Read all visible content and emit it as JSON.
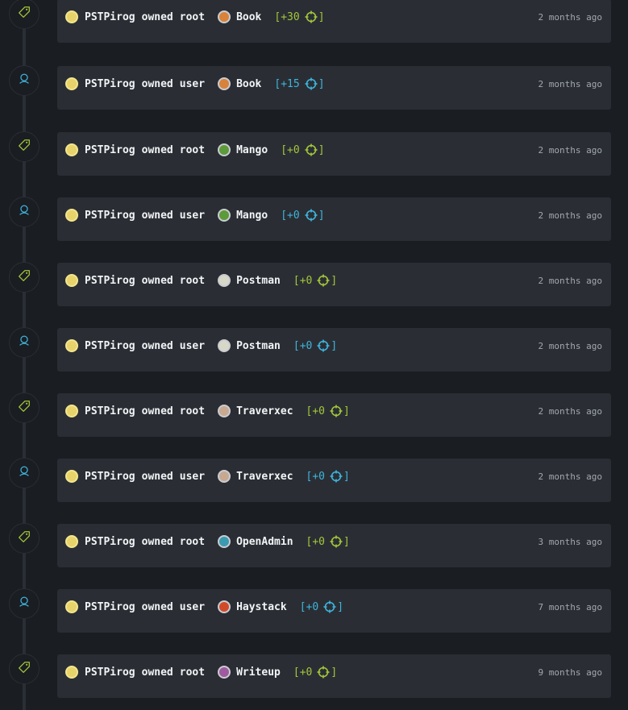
{
  "colors": {
    "root": "#a4c63a",
    "user": "#3fb4dc"
  },
  "feed": [
    {
      "type": "root",
      "icon": "tag-icon",
      "user": "PSTPirog",
      "verb": "owned",
      "what": "root",
      "machine": "Book",
      "points": "[+30",
      "close": "]",
      "time": "2 months ago",
      "avatar_color": "#d9823a"
    },
    {
      "type": "user",
      "icon": "user-icon",
      "user": "PSTPirog",
      "verb": "owned",
      "what": "user",
      "machine": "Book",
      "points": "[+15",
      "close": "]",
      "time": "2 months ago",
      "avatar_color": "#d9823a"
    },
    {
      "type": "root",
      "icon": "tag-icon",
      "user": "PSTPirog",
      "verb": "owned",
      "what": "root",
      "machine": "Mango",
      "points": "[+0",
      "close": "]",
      "time": "2 months ago",
      "avatar_color": "#5c9a3a"
    },
    {
      "type": "user",
      "icon": "user-icon",
      "user": "PSTPirog",
      "verb": "owned",
      "what": "user",
      "machine": "Mango",
      "points": "[+0",
      "close": "]",
      "time": "2 months ago",
      "avatar_color": "#5c9a3a"
    },
    {
      "type": "root",
      "icon": "tag-icon",
      "user": "PSTPirog",
      "verb": "owned",
      "what": "root",
      "machine": "Postman",
      "points": "[+0",
      "close": "]",
      "time": "2 months ago",
      "avatar_color": "#d8d8c8"
    },
    {
      "type": "user",
      "icon": "user-icon",
      "user": "PSTPirog",
      "verb": "owned",
      "what": "user",
      "machine": "Postman",
      "points": "[+0",
      "close": "]",
      "time": "2 months ago",
      "avatar_color": "#d8d8c8"
    },
    {
      "type": "root",
      "icon": "tag-icon",
      "user": "PSTPirog",
      "verb": "owned",
      "what": "root",
      "machine": "Traverxec",
      "points": "[+0",
      "close": "]",
      "time": "2 months ago",
      "avatar_color": "#c8a890"
    },
    {
      "type": "user",
      "icon": "user-icon",
      "user": "PSTPirog",
      "verb": "owned",
      "what": "user",
      "machine": "Traverxec",
      "points": "[+0",
      "close": "]",
      "time": "2 months ago",
      "avatar_color": "#c8a890"
    },
    {
      "type": "root",
      "icon": "tag-icon",
      "user": "PSTPirog",
      "verb": "owned",
      "what": "root",
      "machine": "OpenAdmin",
      "points": "[+0",
      "close": "]",
      "time": "3 months ago",
      "avatar_color": "#3a9ab0"
    },
    {
      "type": "user",
      "icon": "user-icon",
      "user": "PSTPirog",
      "verb": "owned",
      "what": "user",
      "machine": "Haystack",
      "points": "[+0",
      "close": "]",
      "time": "7 months ago",
      "avatar_color": "#d04a2a"
    },
    {
      "type": "root",
      "icon": "tag-icon",
      "user": "PSTPirog",
      "verb": "owned",
      "what": "root",
      "machine": "Writeup",
      "points": "[+0",
      "close": "]",
      "time": "9 months ago",
      "avatar_color": "#a05aa0"
    }
  ]
}
